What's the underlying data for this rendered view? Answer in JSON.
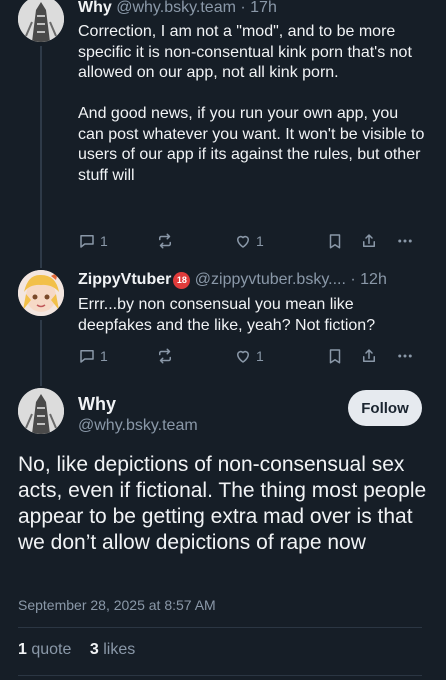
{
  "posts": [
    {
      "author_name": "Why",
      "author_handle": "@why.bsky.team",
      "time": "· 17h",
      "paragraphs": [
        "Correction, I am not a \"mod\", and to be more specific it is non-consentual kink porn that's not allowed on our app, not all kink porn.",
        "And good news, if you run your own app, you can post whatever you want. It won't be visible to users of our app if its against the rules, but other stuff will"
      ],
      "reply_count": "1",
      "like_count": "1"
    },
    {
      "author_name": "ZippyVtuber",
      "author_badge": "18",
      "author_handle": "@zippyvtuber.bsky....",
      "time": "· 12h",
      "paragraphs": [
        "Errr...by non consensual you mean like deepfakes and the like, yeah? Not fiction?"
      ],
      "reply_count": "1",
      "like_count": "1"
    }
  ],
  "main_post": {
    "author_name": "Why",
    "author_handle": "@why.bsky.team",
    "follow_label": "Follow",
    "text": "No, like depictions of non-consensual sex acts, even if fictional. The thing most people appear to be getting extra mad over is that we don’t allow depictions of rape now",
    "timestamp": "September 28, 2025 at 8:57 AM",
    "quote_count": "1",
    "quote_label": "quote",
    "like_count": "3",
    "like_label": "likes"
  },
  "icons": {
    "reply": "reply-bubble-icon",
    "repost": "repost-arrows-icon",
    "like": "heart-icon",
    "bookmark": "bookmark-icon",
    "share": "share-icon",
    "more": "ellipsis-icon"
  },
  "colors": {
    "background": "#161e27",
    "text": "#f1f3f5",
    "muted": "#8a98a8",
    "follow_button": "#e6eaef",
    "adult_badge": "#e03b3b"
  }
}
